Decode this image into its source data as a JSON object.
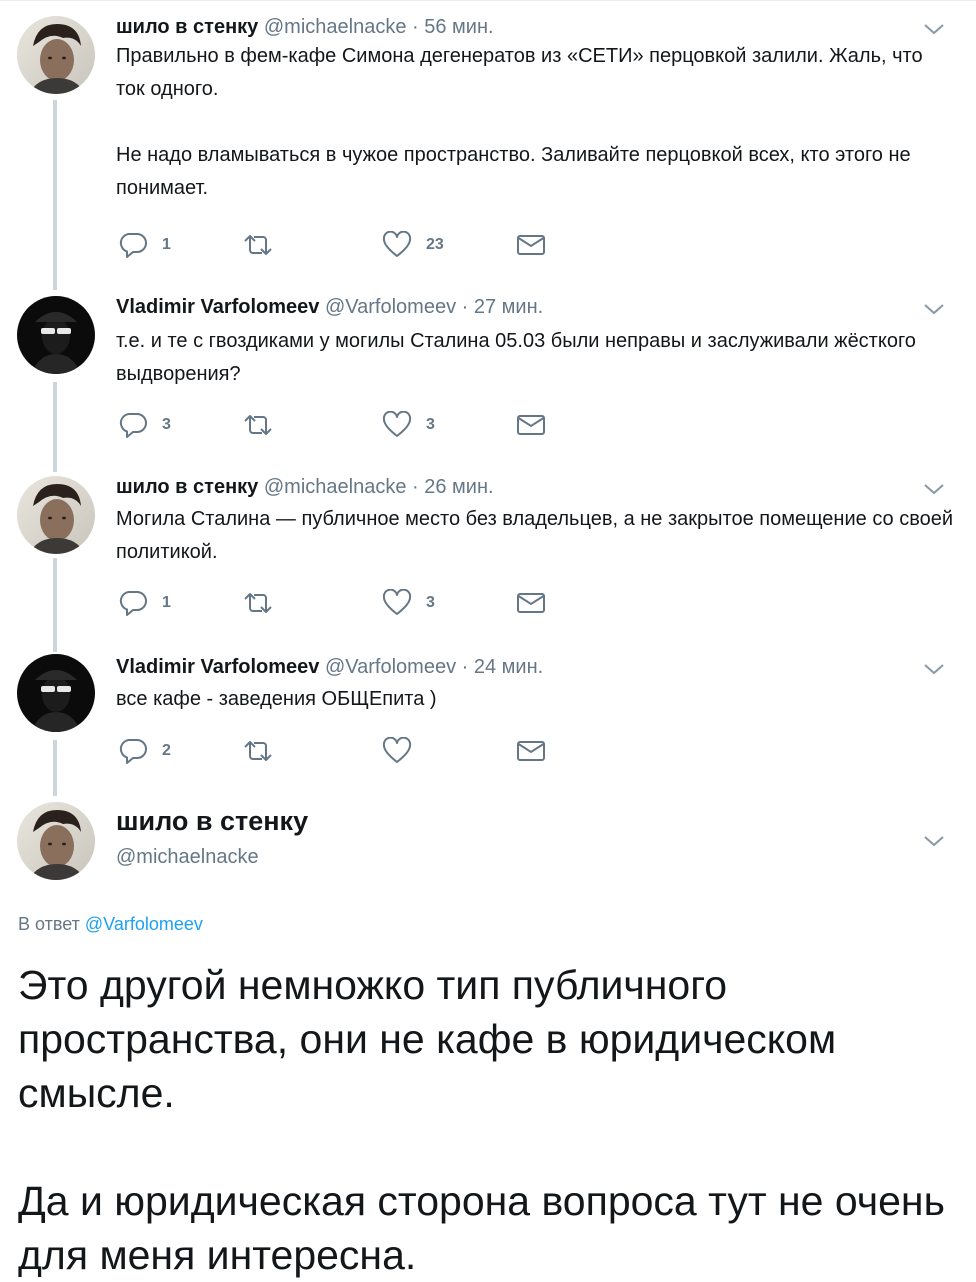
{
  "tweets": [
    {
      "fullname": "шило в стенку",
      "username": "@michaelnacke",
      "separator": "·",
      "time": "56 мин.",
      "paragraphs": [
        "Правильно в фем-кафе Симона дегенератов из «СЕТИ» перцовкой залили. Жаль, что ток одного.",
        "Не надо вламываться в чужое пространство. Заливайте перцовкой всех, кто этого не понимает."
      ],
      "reply_count": "1",
      "retweet_count": "",
      "like_count": "23"
    },
    {
      "fullname": "Vladimir Varfolomeev",
      "username": "@Varfolomeev",
      "separator": "·",
      "time": "27 мин.",
      "paragraphs": [
        "т.е. и те с гвоздиками у могилы Сталина 05.03 были неправы и заслуживали жёсткого выдворения?"
      ],
      "reply_count": "3",
      "retweet_count": "",
      "like_count": "3"
    },
    {
      "fullname": "шило в стенку",
      "username": "@michaelnacke",
      "separator": "·",
      "time": "26 мин.",
      "paragraphs": [
        "Могила Сталина — публичное место без владельцев, а не закрытое помещение со своей политикой."
      ],
      "reply_count": "1",
      "retweet_count": "",
      "like_count": "3"
    },
    {
      "fullname": "Vladimir Varfolomeev",
      "username": "@Varfolomeev",
      "separator": "·",
      "time": "24 мин.",
      "paragraphs": [
        "все кафе - заведения ОБЩЕпита )"
      ],
      "reply_count": "2",
      "retweet_count": "",
      "like_count": ""
    }
  ],
  "main_tweet": {
    "fullname": "шило в стенку",
    "username": "@michaelnacke",
    "reply_prefix": "В ответ",
    "reply_to": "@Varfolomeev",
    "paragraphs": [
      "Это другой немножко тип публичного пространства, они не кафе в юридическом смысле.",
      "Да и юридическая сторона вопроса тут не очень для меня интересна."
    ]
  },
  "colors": {
    "text": "#14171a",
    "secondary": "#657786",
    "link": "#1da1f2",
    "thread_line": "#ccd6dd"
  },
  "icons": {
    "reply": "reply-icon",
    "retweet": "retweet-icon",
    "like": "heart-icon",
    "dm": "envelope-icon",
    "caret": "chevron-down-icon"
  }
}
